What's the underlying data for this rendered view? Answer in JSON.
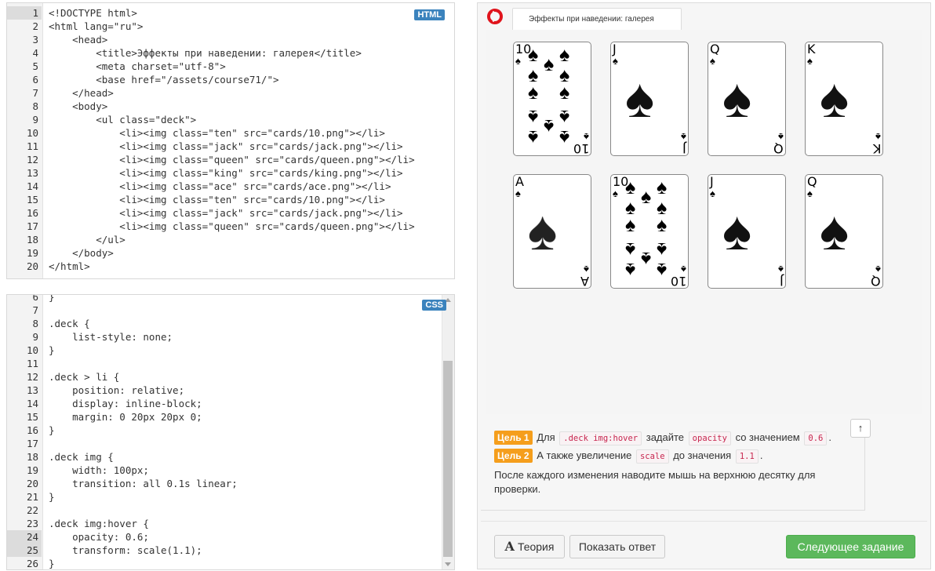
{
  "html_editor": {
    "badge": "HTML",
    "lines": [
      {
        "n": "1",
        "code": "<!DOCTYPE html>"
      },
      {
        "n": "2",
        "code": "<html lang=\"ru\">"
      },
      {
        "n": "3",
        "code": "    <head>"
      },
      {
        "n": "4",
        "code": "        <title>Эффекты при наведении: галерея</title>"
      },
      {
        "n": "5",
        "code": "        <meta charset=\"utf-8\">"
      },
      {
        "n": "6",
        "code": "        <base href=\"/assets/course71/\">"
      },
      {
        "n": "7",
        "code": "    </head>"
      },
      {
        "n": "8",
        "code": "    <body>"
      },
      {
        "n": "9",
        "code": "        <ul class=\"deck\">"
      },
      {
        "n": "10",
        "code": "            <li><img class=\"ten\" src=\"cards/10.png\"></li>"
      },
      {
        "n": "11",
        "code": "            <li><img class=\"jack\" src=\"cards/jack.png\"></li>"
      },
      {
        "n": "12",
        "code": "            <li><img class=\"queen\" src=\"cards/queen.png\"></li>"
      },
      {
        "n": "13",
        "code": "            <li><img class=\"king\" src=\"cards/king.png\"></li>"
      },
      {
        "n": "14",
        "code": "            <li><img class=\"ace\" src=\"cards/ace.png\"></li>"
      },
      {
        "n": "15",
        "code": "            <li><img class=\"ten\" src=\"cards/10.png\"></li>"
      },
      {
        "n": "16",
        "code": "            <li><img class=\"jack\" src=\"cards/jack.png\"></li>"
      },
      {
        "n": "17",
        "code": "            <li><img class=\"queen\" src=\"cards/queen.png\"></li>"
      },
      {
        "n": "18",
        "code": "        </ul>"
      },
      {
        "n": "19",
        "code": "    </body>"
      },
      {
        "n": "20",
        "code": "</html>"
      }
    ]
  },
  "css_editor": {
    "badge": "CSS",
    "lines": [
      {
        "n": "6",
        "code": "}"
      },
      {
        "n": "7",
        "code": ""
      },
      {
        "n": "8",
        "code": ".deck {"
      },
      {
        "n": "9",
        "code": "    list-style: none;"
      },
      {
        "n": "10",
        "code": "}"
      },
      {
        "n": "11",
        "code": ""
      },
      {
        "n": "12",
        "code": ".deck > li {"
      },
      {
        "n": "13",
        "code": "    position: relative;"
      },
      {
        "n": "14",
        "code": "    display: inline-block;"
      },
      {
        "n": "15",
        "code": "    margin: 0 20px 20px 0;"
      },
      {
        "n": "16",
        "code": "}"
      },
      {
        "n": "17",
        "code": ""
      },
      {
        "n": "18",
        "code": ".deck img {"
      },
      {
        "n": "19",
        "code": "    width: 100px;"
      },
      {
        "n": "20",
        "code": "    transition: all 0.1s linear;"
      },
      {
        "n": "21",
        "code": "}"
      },
      {
        "n": "22",
        "code": ""
      },
      {
        "n": "23",
        "code": ".deck img:hover {"
      },
      {
        "n": "24",
        "code": "    opacity: 0.6;"
      },
      {
        "n": "25",
        "code": "    transform: scale(1.1);"
      },
      {
        "n": "26",
        "code": "}"
      }
    ]
  },
  "browser": {
    "tab_title": "Эффекты при наведении: галерея",
    "cards": [
      {
        "rank": "10",
        "kind": "ten"
      },
      {
        "rank": "J",
        "kind": "face"
      },
      {
        "rank": "Q",
        "kind": "face"
      },
      {
        "rank": "K",
        "kind": "face"
      },
      {
        "rank": "A",
        "kind": "ace"
      },
      {
        "rank": "10",
        "kind": "ten"
      },
      {
        "rank": "J",
        "kind": "face"
      },
      {
        "rank": "Q",
        "kind": "face"
      }
    ]
  },
  "task": {
    "goal1": {
      "badge": "Цель 1",
      "t1": "Для",
      "code1": ".deck img:hover",
      "t2": "задайте",
      "code2": "opacity",
      "t3": "со значением",
      "code3": "0.6",
      "t4": "."
    },
    "goal2": {
      "badge": "Цель 2",
      "t1": "А также увеличение",
      "code1": "scale",
      "t2": "до значения",
      "code2": "1.1",
      "t3": "."
    },
    "note": "После каждого изменения наводите мышь на верхнюю десятку для проверки.",
    "up_icon": "arrow-up-icon",
    "up_glyph": "↑"
  },
  "buttons": {
    "theory_icon": "A",
    "theory": "Теория",
    "answer": "Показать ответ",
    "next": "Следующее задание"
  }
}
